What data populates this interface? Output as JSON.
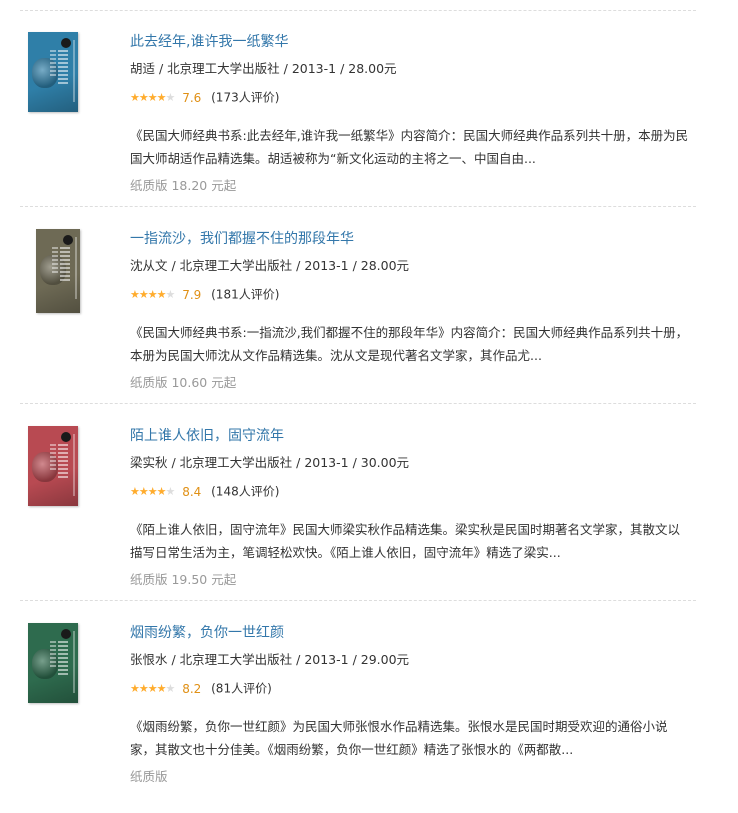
{
  "books": [
    {
      "title": "此去经年,谁许我一纸繁华",
      "meta": "胡适 / 北京理工大学出版社 / 2013-1 / 28.00元",
      "stars_filled": 4,
      "rating": "7.6",
      "rating_count": "(173人评价)",
      "description": "《民国大师经典书系:此去经年,谁许我一纸繁华》内容简介：民国大师经典作品系列共十册，本册为民国大师胡适作品精选集。胡适被称为“新文化运动的主将之一、中国自由...",
      "price": "纸质版 18.20 元起",
      "cover_color": "#2f7fa8"
    },
    {
      "title": "一指流沙，我们都握不住的那段年华",
      "meta": "沈从文 / 北京理工大学出版社 / 2013-1 / 28.00元",
      "stars_filled": 4,
      "rating": "7.9",
      "rating_count": "(181人评价)",
      "description": "《民国大师经典书系:一指流沙,我们都握不住的那段年华》内容简介：民国大师经典作品系列共十册，本册为民国大师沈从文作品精选集。沈从文是现代著名文学家，其作品尤...",
      "price": "纸质版 10.60 元起",
      "cover_color": "#6e6a55"
    },
    {
      "title": "陌上谁人依旧，固守流年",
      "meta": "梁实秋 / 北京理工大学出版社 / 2013-1 / 30.00元",
      "stars_filled": 4,
      "rating": "8.4",
      "rating_count": "(148人评价)",
      "description": "《陌上谁人依旧，固守流年》民国大师梁实秋作品精选集。梁实秋是民国时期著名文学家，其散文以描写日常生活为主，笔调轻松欢快。《陌上谁人依旧，固守流年》精选了梁实...",
      "price": "纸质版 19.50 元起",
      "cover_color": "#b84a52"
    },
    {
      "title": "烟雨纷繁，负你一世红颜",
      "meta": "张恨水 / 北京理工大学出版社 / 2013-1 / 29.00元",
      "stars_filled": 4,
      "rating": "8.2",
      "rating_count": "(81人评价)",
      "description": "《烟雨纷繁，负你一世红颜》为民国大师张恨水作品精选集。张恨水是民国时期受欢迎的通俗小说家，其散文也十分佳美。《烟雨纷繁，负你一世红颜》精选了张恨水的《两都散...",
      "price": "纸质版 ",
      "cover_color": "#2e6b4e"
    }
  ]
}
